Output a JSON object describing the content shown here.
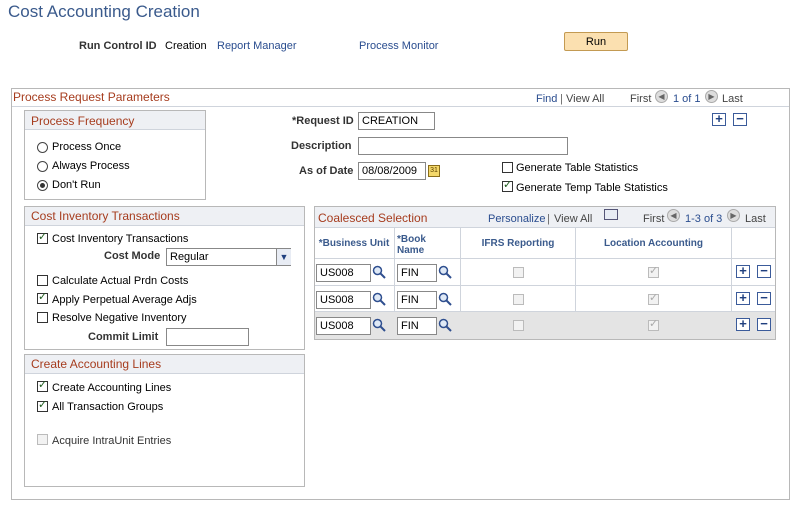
{
  "page": {
    "title": "Cost Accounting Creation"
  },
  "header": {
    "run_control_label": "Run Control ID",
    "run_control_value": "Creation",
    "report_manager": "Report Manager",
    "process_monitor": "Process Monitor",
    "run_button": "Run"
  },
  "params": {
    "title": "Process Request Parameters",
    "find": "Find",
    "sep": "|",
    "view_all": "View All",
    "first": "First",
    "count": "1 of 1",
    "last": "Last",
    "request_id_label": "*Request ID",
    "request_id_value": "CREATION",
    "description_label": "Description",
    "description_value": "",
    "as_of_date_label": "As of Date",
    "as_of_date_value": "08/08/2009",
    "gen_table_stats": "Generate Table Statistics",
    "gen_temp_table_stats": "Generate Temp Table Statistics"
  },
  "frequency": {
    "title": "Process Frequency",
    "options": [
      "Process Once",
      "Always Process",
      "Don't Run"
    ],
    "selected": "Don't Run"
  },
  "cost_inv": {
    "title": "Cost Inventory Transactions",
    "cit_label": "Cost Inventory Transactions",
    "cost_mode_label": "Cost Mode",
    "cost_mode_value": "Regular",
    "calc_actual": "Calculate Actual Prdn Costs",
    "apply_perpetual": "Apply Perpetual Average Adjs",
    "resolve_negative": "Resolve Negative Inventory",
    "commit_limit_label": "Commit Limit",
    "commit_limit_value": ""
  },
  "accounting": {
    "title": "Create Accounting Lines",
    "create_lines": "Create Accounting Lines",
    "all_groups": "All Transaction Groups",
    "acquire_intraunit": "Acquire IntraUnit Entries"
  },
  "coalesced": {
    "title": "Coalesced Selection",
    "personalize": "Personalize",
    "sep": "|",
    "view_all": "View All",
    "first": "First",
    "count": "1-3 of 3",
    "last": "Last",
    "col_bu": "*Business Unit",
    "col_book_1": "*Book",
    "col_book_2": "Name",
    "col_ifrs": "IFRS Reporting",
    "col_loc": "Location Accounting",
    "rows": [
      {
        "bu": "US008",
        "book": "FIN"
      },
      {
        "bu": "US008",
        "book": "FIN"
      },
      {
        "bu": "US008",
        "book": "FIN"
      }
    ]
  },
  "colors": {
    "title_blue": "#3a5a8c",
    "section_red": "#a63c1e",
    "link_blue": "#2a4d8f",
    "run_button_bg": "#fbe0b0"
  },
  "icons": {
    "lookup": "magnifier-icon",
    "calendar": "calendar-icon",
    "add": "plus-icon",
    "remove": "minus-icon"
  }
}
